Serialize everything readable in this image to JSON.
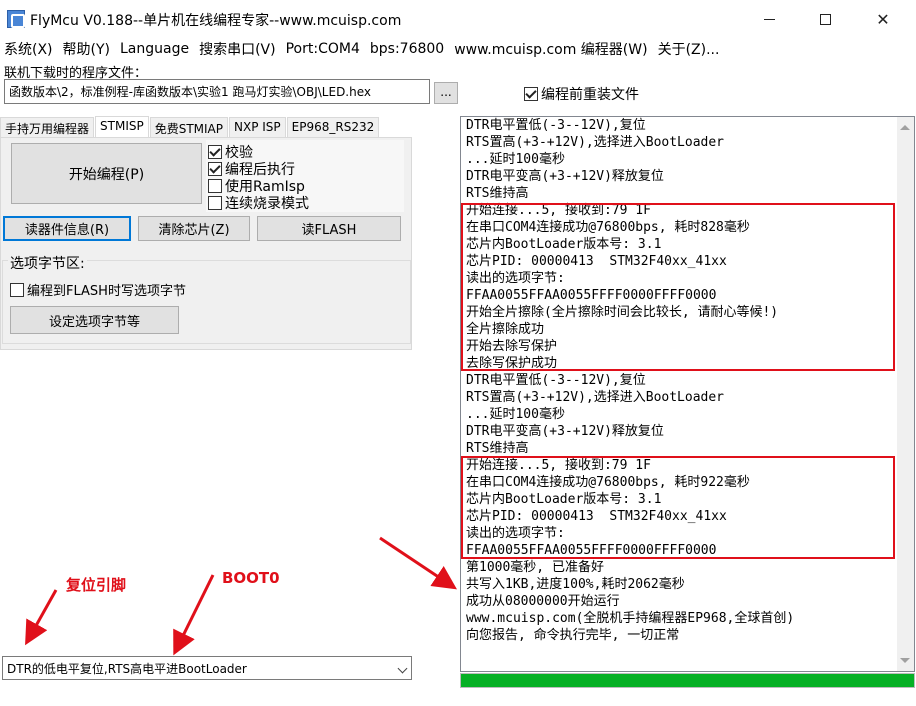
{
  "window": {
    "title": "FlyMcu V0.188--单片机在线编程专家--www.mcuisp.com"
  },
  "menu": [
    "系统(X)",
    "帮助(Y)",
    "Language",
    "搜索串口(V)",
    "Port:COM4",
    "bps:76800",
    "www.mcuisp.com 编程器(W)",
    "关于(Z)..."
  ],
  "file": {
    "label": "联机下载时的程序文件：",
    "path": "函数版本\\2，标准例程-库函数版本\\实验1 跑马灯实验\\OBJ\\LED.hex",
    "browse_label": "...",
    "reload_label": "编程前重装文件",
    "reload_checked": true
  },
  "tabs": [
    "手持万用编程器",
    "STMISP",
    "免费STMIAP",
    "NXP ISP",
    "EP968_RS232"
  ],
  "buttons": {
    "start": "开始编程(P)",
    "read_info": "读器件信息(R)",
    "erase": "清除芯片(Z)",
    "read_flash": "读FLASH"
  },
  "options": [
    {
      "label": "校验",
      "checked": true
    },
    {
      "label": "编程后执行",
      "checked": true
    },
    {
      "label": "使用RamIsp",
      "checked": false
    },
    {
      "label": "连续烧录模式",
      "checked": false
    }
  ],
  "option_bytes": {
    "title": "选项字节区:",
    "write_label": "编程到FLASH时写选项字节",
    "write_checked": false,
    "set_button": "设定选项字节等"
  },
  "log_lines": [
    "DTR电平置低(-3--12V),复位",
    "RTS置高(+3-+12V),选择进入BootLoader",
    "...延时100毫秒",
    "DTR电平变高(+3-+12V)释放复位",
    "RTS维持高",
    "开始连接...5, 接收到:79 1F",
    "在串口COM4连接成功@76800bps, 耗时828毫秒",
    "芯片内BootLoader版本号: 3.1",
    "芯片PID: 00000413  STM32F40xx_41xx",
    "读出的选项字节:",
    "FFAA0055FFAA0055FFFF0000FFFF0000",
    "开始全片擦除(全片擦除时间会比较长, 请耐心等候!)",
    "全片擦除成功",
    "开始去除写保护",
    "去除写保护成功",
    "DTR电平置低(-3--12V),复位",
    "RTS置高(+3-+12V),选择进入BootLoader",
    "...延时100毫秒",
    "DTR电平变高(+3-+12V)释放复位",
    "RTS维持高",
    "开始连接...5, 接收到:79 1F",
    "在串口COM4连接成功@76800bps, 耗时922毫秒",
    "芯片内BootLoader版本号: 3.1",
    "芯片PID: 00000413  STM32F40xx_41xx",
    "读出的选项字节:",
    "FFAA0055FFAA0055FFFF0000FFFF0000",
    "第1000毫秒, 已准备好",
    "共写入1KB,进度100%,耗时2062毫秒",
    "成功从08000000开始运行",
    "www.mcuisp.com(全脱机手持编程器EP968,全球首创)",
    "向您报告, 命令执行完毕, 一切正常"
  ],
  "progress": {
    "fraction": 1.0,
    "color": "#06b025"
  },
  "reset_mode": "DTR的低电平复位,RTS高电平进BootLoader",
  "annotations": {
    "reset_pin": "复位引脚",
    "boot0": "BOOT0"
  },
  "colors": {
    "annotation": "#e0101a"
  }
}
